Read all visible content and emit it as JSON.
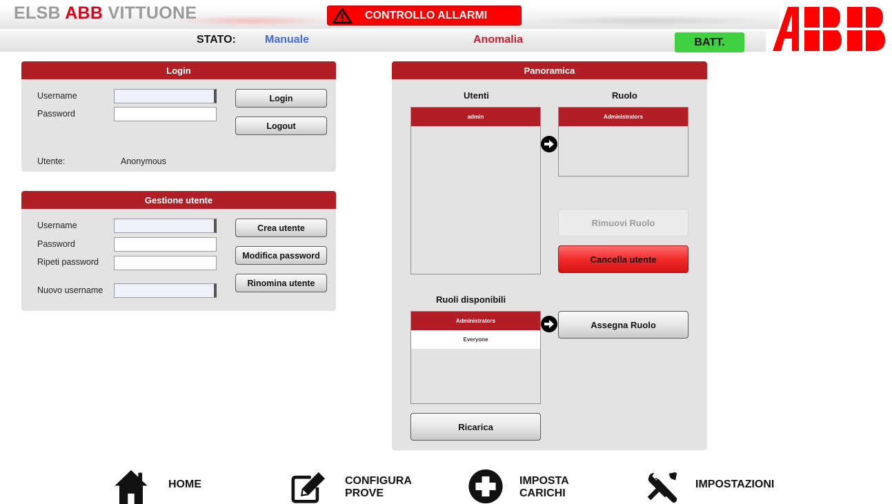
{
  "header": {
    "title_part1": "ELSB",
    "title_part2": "ABB",
    "title_part3": "VITTUONE",
    "alarm_label": "CONTROLLO ALLARMI",
    "stato_label": "STATO:",
    "stato_value": "Manuale",
    "anomaly": "Anomalia",
    "battery": "BATT."
  },
  "login_panel": {
    "title": "Login",
    "username_label": "Username",
    "password_label": "Password",
    "username_value": "",
    "password_value": "",
    "login_button": "Login",
    "logout_button": "Logout",
    "user_label": "Utente:",
    "user_value": "Anonymous"
  },
  "user_mgmt": {
    "title": "Gestione utente",
    "username_label": "Username",
    "password_label": "Password",
    "repeat_label": "Ripeti password",
    "new_username_label": "Nuovo username",
    "create_button": "Crea utente",
    "modify_button": "Modifica password",
    "rename_button": "Rinomina utente"
  },
  "overview": {
    "title": "Panoramica",
    "users_title": "Utenti",
    "role_title": "Ruolo",
    "users": [
      "admin"
    ],
    "user_roles": [
      "Administrators"
    ],
    "remove_role_button": "Rimuovi Ruolo",
    "delete_user_button": "Cancella utente",
    "available_title": "Ruoli disponibili",
    "available_roles": [
      "Administrators",
      "Everyone"
    ],
    "assign_role_button": "Assegna Ruolo",
    "reload_button": "Ricarica"
  },
  "nav": {
    "home": "HOME",
    "config_1": "CONFIGURA",
    "config_2": "PROVE",
    "loads_1": "IMPOSTA",
    "loads_2": "CARICHI",
    "settings": "IMPOSTAZIONI"
  },
  "colors": {
    "panel_header": "#b21e25",
    "alarm": "#ff0000",
    "battery": "#3fd13f",
    "stato": "#4169e1",
    "anomaly": "#c41e2a"
  }
}
